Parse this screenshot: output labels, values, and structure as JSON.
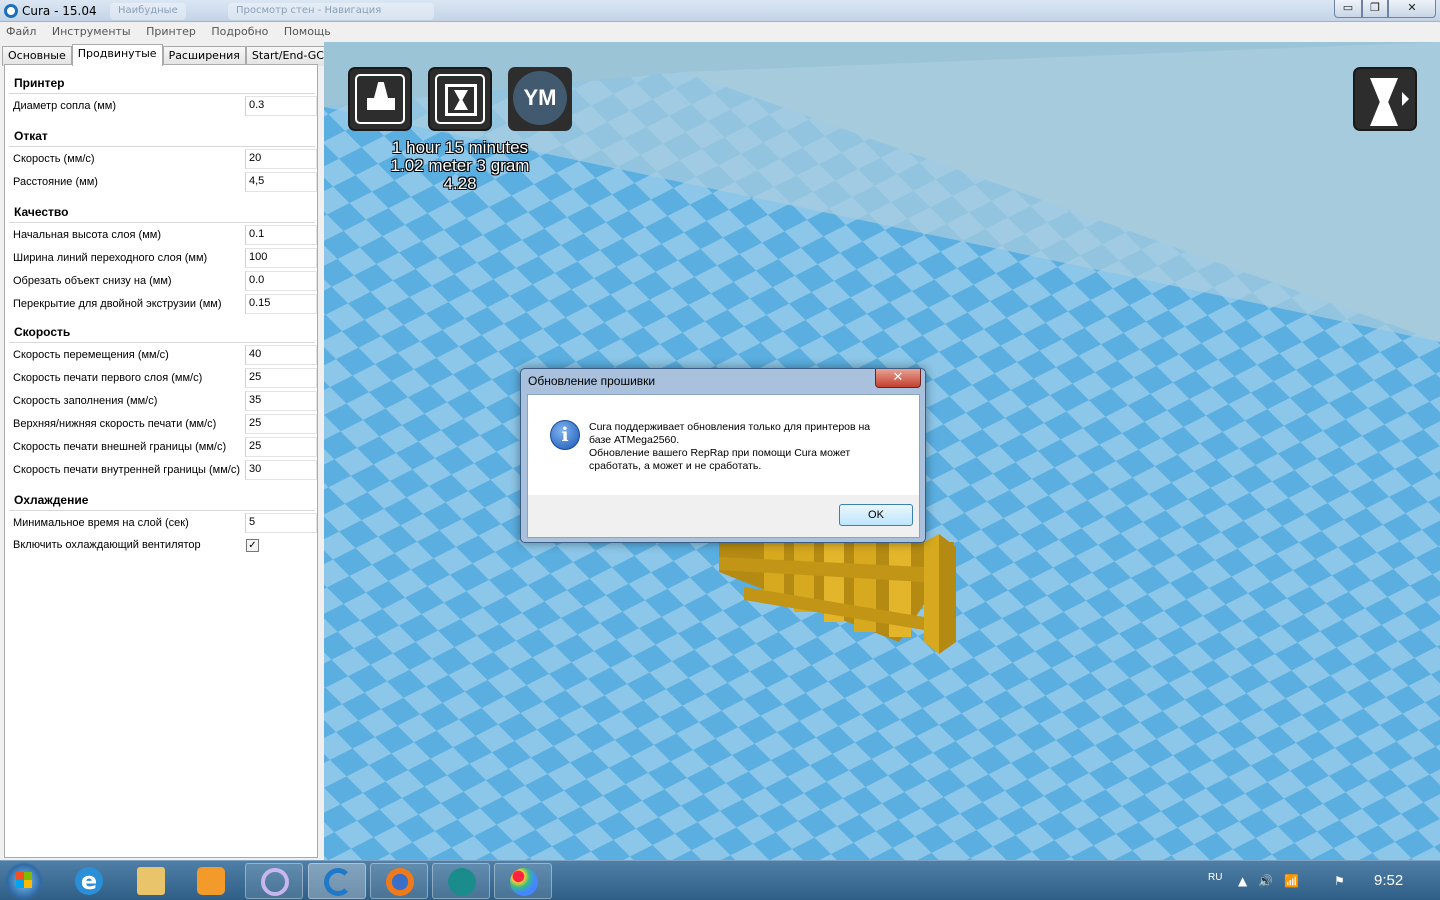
{
  "window": {
    "title": "Cura - 15.04",
    "ghost_tabs": [
      "Наибудные",
      "Просмотр стен - Навигация"
    ],
    "controls": {
      "minimize": "▭",
      "maximize": "❐",
      "close": "✕"
    }
  },
  "menu": [
    "Файл",
    "Инструменты",
    "Принтер",
    "Подробно",
    "Помощь"
  ],
  "tabs": [
    "Основные",
    "Продвинутые",
    "Расширения",
    "Start/End-GCode"
  ],
  "active_tab": "Продвинутые",
  "settings": {
    "printer": {
      "title": "Принтер",
      "rows": [
        {
          "label": "Диаметр сопла (мм)",
          "value": "0.3"
        }
      ]
    },
    "retraction": {
      "title": "Откат",
      "rows": [
        {
          "label": "Скорость (мм/с)",
          "value": "20"
        },
        {
          "label": "Расстояние (мм)",
          "value": "4,5"
        }
      ]
    },
    "quality": {
      "title": "Качество",
      "rows": [
        {
          "label": "Начальная высота слоя (мм)",
          "value": "0.1"
        },
        {
          "label": "Ширина линий переходного слоя (мм)",
          "value": "100"
        },
        {
          "label": "Обрезать объект снизу на (мм)",
          "value": "0.0"
        },
        {
          "label": "Перекрытие для двойной экструзии (мм)",
          "value": "0.15"
        }
      ]
    },
    "speed": {
      "title": "Скорость",
      "rows": [
        {
          "label": "Скорость перемещения (мм/с)",
          "value": "40"
        },
        {
          "label": "Скорость печати первого слоя (мм/с)",
          "value": "25"
        },
        {
          "label": "Скорость заполнения (мм/с)",
          "value": "35"
        },
        {
          "label": "Верхняя/нижняя скорость печати (мм/с)",
          "value": "25"
        },
        {
          "label": "Скорость печати внешней границы (мм/с)",
          "value": "25"
        },
        {
          "label": "Скорость печати внутренней границы (мм/с)",
          "value": "30"
        }
      ]
    },
    "cooling": {
      "title": "Охлаждение",
      "rows": [
        {
          "label": "Минимальное время на слой (сек)",
          "value": "5"
        },
        {
          "label": "Включить охлаждающий вентилятор",
          "checked": true,
          "check_mark": "✓"
        }
      ]
    }
  },
  "viewport": {
    "print_time": "1 hour 15 minutes",
    "material": "1.02 meter 3 gram",
    "cost": "4.28",
    "ym_label": "YM",
    "colors": {
      "floor_a": "#5aaee0",
      "floor_b": "#8cc6e8",
      "model": "#d7a91f",
      "background": "#9bc5d6"
    }
  },
  "dialog": {
    "title": "Обновление прошивки",
    "close_label": "✕",
    "icon": "i",
    "message_lines": [
      "Cura поддерживает обновления только для принтеров на",
      "базе ATMega2560.",
      "Обновление вашего RepRap при помощи Cura может",
      "сработать, а может и не сработать."
    ],
    "ok_label": "OK"
  },
  "taskbar": {
    "apps": [
      "start-orb",
      "internet-explorer",
      "file-explorer",
      "media-player",
      "cura-ghost",
      "cura",
      "firefox",
      "arduino",
      "paint"
    ],
    "language": "RU",
    "tray_icons": [
      "▲",
      "🔊",
      "📶",
      "⚑"
    ],
    "clock": "9:52"
  }
}
